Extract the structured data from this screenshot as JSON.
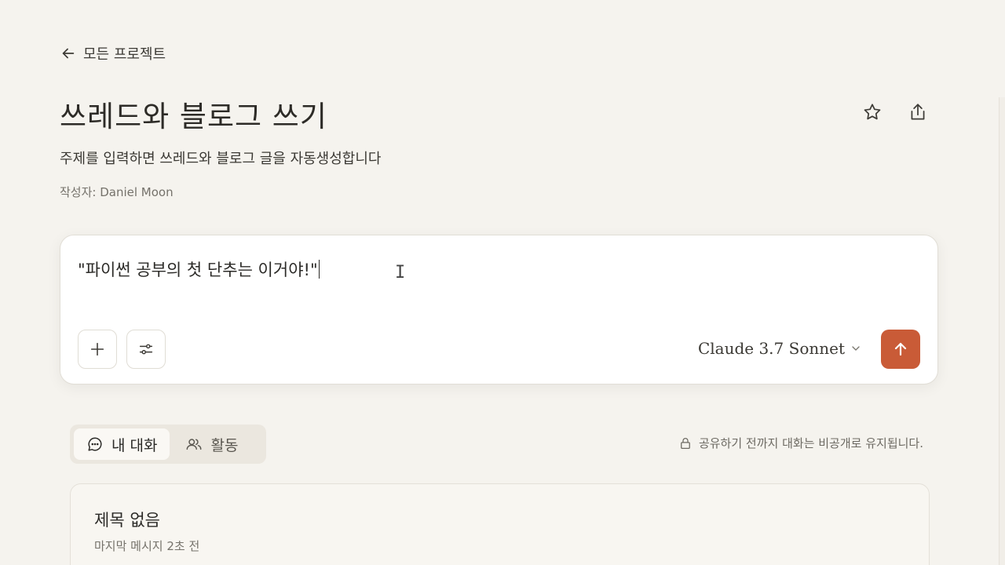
{
  "nav": {
    "back_label": "모든 프로젝트"
  },
  "project": {
    "title": "쓰레드와 블로그 쓰기",
    "description": "주제를 입력하면 쓰레드와 블로그 글을 자동생성합니다",
    "author": "작성자: Daniel Moon"
  },
  "composer": {
    "input_value": "\"파이썬 공부의 첫 단추는 이거야!\"",
    "model_label": "Claude 3.7 Sonnet"
  },
  "tabs": [
    {
      "label": "내 대화",
      "icon": "chat-bubble-icon",
      "active": true
    },
    {
      "label": "활동",
      "icon": "users-icon",
      "active": false
    }
  ],
  "privacy_note": "공유하기 전까지 대화는 비공개로 유지됩니다.",
  "conversation": {
    "title": "제목 없음",
    "meta": "마지막 메시지 2초 전"
  },
  "colors": {
    "background": "#f5f3ee",
    "accent": "#c95b37",
    "card": "#ffffff"
  }
}
